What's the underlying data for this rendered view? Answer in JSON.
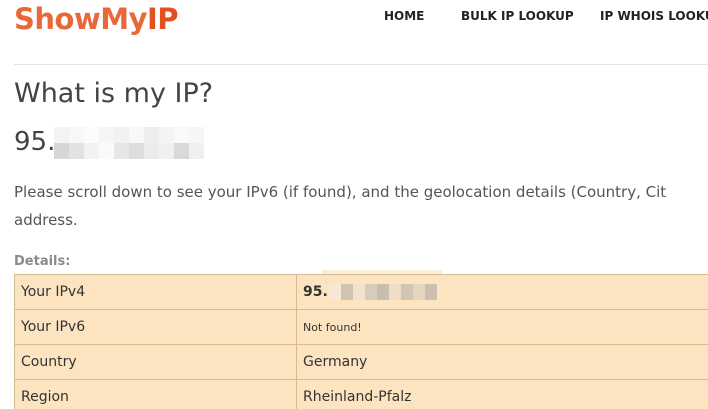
{
  "header": {
    "logo_part1": "ShowMy",
    "logo_part2": "IP",
    "nav": {
      "home": "HOME",
      "bulk": "BULK IP LOOKUP",
      "whois": "IP WHOIS LOOKUP"
    }
  },
  "main": {
    "title": "What is my IP?",
    "ip_prefix": "95.",
    "intro_line1": "Please scroll down to see your IPv6 (if found), and the geolocation details (Country, Cit",
    "intro_line2": "address.",
    "details_label": "Details:"
  },
  "details": {
    "rows": [
      {
        "key": "Your IPv4",
        "value": "95."
      },
      {
        "key": "Your IPv6",
        "value": "Not found!"
      },
      {
        "key": "Country",
        "value": "Germany"
      },
      {
        "key": "Region",
        "value": "Rheinland-Pfalz"
      }
    ]
  },
  "colors": {
    "brand": "#e34f1f",
    "table_bg": "#fde4c1",
    "table_border": "#d9b98f"
  }
}
